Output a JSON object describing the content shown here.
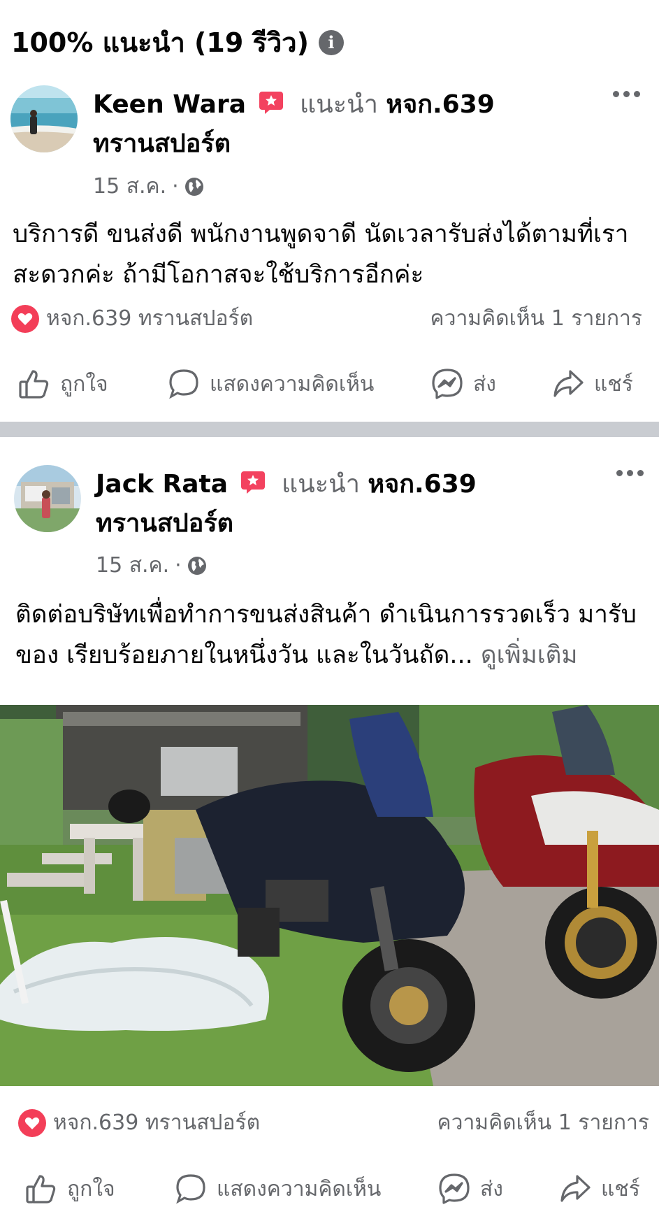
{
  "header": {
    "title": "100% แนะนำ (19 รีวิว)",
    "info_icon": "info-icon"
  },
  "posts": [
    {
      "author": "Keen Wara",
      "recommends": "แนะนำ",
      "page": "หจก.639 ทรานสปอร์ต",
      "date": "15 ส.ค.",
      "separator": "·",
      "text": "บริการดี ขนส่งดี พนักงานพูดจาดี นัดเวลารับส่งได้ตามที่เราสะดวกค่ะ ถ้ามีโอกาสจะใช้บริการอีกค่ะ",
      "reaction_by": "หจก.639 ทรานสปอร์ต",
      "comments": "ความคิดเห็น 1 รายการ"
    },
    {
      "author": "Jack Rata",
      "recommends": "แนะนำ",
      "page": "หจก.639 ทรานสปอร์ต",
      "date": "15 ส.ค.",
      "separator": "·",
      "text": "ติดต่อบริษัทเพื่อทำการขนส่งสินค้า ดำเนินการรวดเร็ว มารับของ เรียบร้อยภายในหนึ่งวัน และในวันถัด...",
      "see_more": "ดูเพิ่มเติม",
      "reaction_by": "หจก.639 ทรานสปอร์ต",
      "comments": "ความคิดเห็น 1 รายการ"
    }
  ],
  "actions": {
    "like": "ถูกใจ",
    "comment": "แสดงความคิดเห็น",
    "send": "ส่ง",
    "share": "แชร์"
  },
  "colors": {
    "heart": "#f33e58",
    "badge": "#f3425f",
    "muted": "#65676b",
    "divider": "#c9ccd1"
  }
}
